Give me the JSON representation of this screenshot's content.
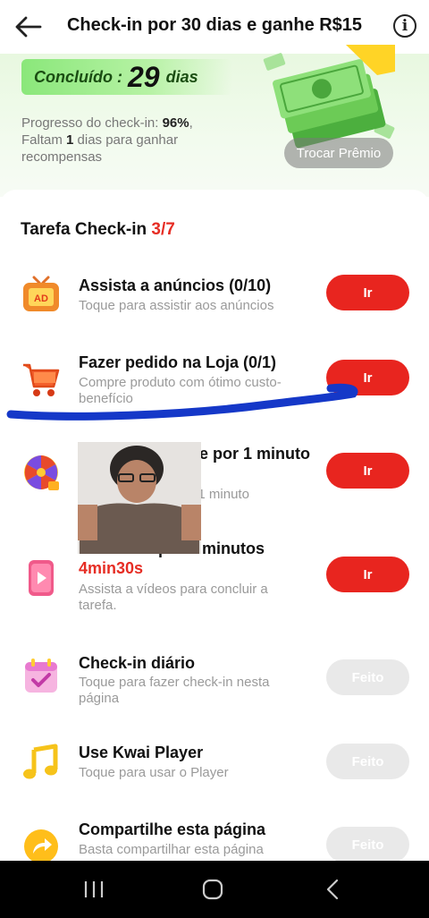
{
  "header": {
    "title": "Check-in por 30 dias e ganhe R$15",
    "back_icon": "arrow-left-icon",
    "info_icon": "info-icon"
  },
  "hero": {
    "done_label": "Concluído :",
    "done_days": "29",
    "done_unit": "dias",
    "progress_prefix": "Progresso do check-in: ",
    "progress_value": "96%",
    "progress_suffix": ",",
    "remaining_prefix": "Faltam ",
    "remaining_value": "1",
    "remaining_suffix": " dias para ganhar recompensas",
    "swap_button": "Trocar Prêmio"
  },
  "tasks_section": {
    "title": "Tarefa Check-in ",
    "count": "3/7"
  },
  "tasks": [
    {
      "name": "Assista a anúncios  (0/10)",
      "desc": "Toque para assistir aos anúncios",
      "button": "Ir",
      "icon": "tv-ad-icon"
    },
    {
      "name": "Fazer pedido na Loja  (0/1)",
      "desc": "Compre produto com ótimo custo-benefício",
      "button": "Ir",
      "icon": "shopping-cart-icon"
    },
    {
      "name": "Jogar ... e Ganhe por 1 minuto",
      "desc": "Jogar ... Ganhe por 1 minuto",
      "button": "Ir",
      "icon": "prize-wheel-icon"
    },
    {
      "name": "Assista ... por 5 minutos ",
      "timer": "4min30s",
      "desc": "Assista a vídeos para concluir a tarefa.",
      "button": "Ir",
      "icon": "video-play-icon"
    },
    {
      "name": "Check-in diário",
      "desc": "Toque para fazer check-in nesta página",
      "button": "Feito",
      "icon": "calendar-check-icon"
    },
    {
      "name": "Use Kwai Player",
      "desc": "Toque para usar o Player",
      "button": "Feito",
      "icon": "music-note-icon"
    },
    {
      "name": "Compartilhe esta página",
      "desc": "Basta compartilhar esta página",
      "button": "Feito",
      "icon": "share-arrow-icon"
    }
  ],
  "colors": {
    "accent_red": "#e8251f",
    "done_gray": "#e9e9e9",
    "hero_green": "#8ae77a"
  },
  "system_nav": {
    "recent_icon": "recent-apps-icon",
    "home_icon": "home-icon",
    "back_icon": "system-back-icon"
  }
}
